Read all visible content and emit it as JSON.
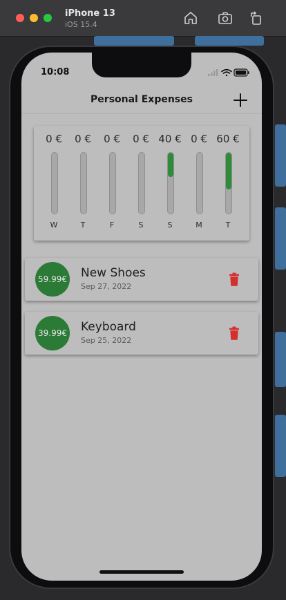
{
  "simulator": {
    "device_name": "iPhone 13",
    "os_version": "iOS 15.4"
  },
  "status_bar": {
    "time": "10:08"
  },
  "app": {
    "title": "Personal Expenses"
  },
  "chart": {
    "currency_symbol": "€",
    "bars": [
      {
        "day": "W",
        "amount_label": "0 €",
        "fill_fraction": 0
      },
      {
        "day": "T",
        "amount_label": "0 €",
        "fill_fraction": 0
      },
      {
        "day": "F",
        "amount_label": "0 €",
        "fill_fraction": 0
      },
      {
        "day": "S",
        "amount_label": "0 €",
        "fill_fraction": 0
      },
      {
        "day": "S",
        "amount_label": "40 €",
        "fill_fraction": 0.4
      },
      {
        "day": "M",
        "amount_label": "0 €",
        "fill_fraction": 0
      },
      {
        "day": "T",
        "amount_label": "60 €",
        "fill_fraction": 0.6
      }
    ]
  },
  "transactions": [
    {
      "amount": "59.99€",
      "title": "New Shoes",
      "date": "Sep 27, 2022"
    },
    {
      "amount": "39.99€",
      "title": "Keyboard",
      "date": "Sep 25, 2022"
    }
  ],
  "colors": {
    "accent": "#2e8b3a",
    "avatar": "#2b7a35",
    "delete": "#d32f2f",
    "background": "#bdbdbd"
  },
  "icons": {
    "add": "plus-icon",
    "delete": "trash-icon",
    "home": "home-icon",
    "screenshot": "camera-icon",
    "rotate": "rotate-icon"
  }
}
